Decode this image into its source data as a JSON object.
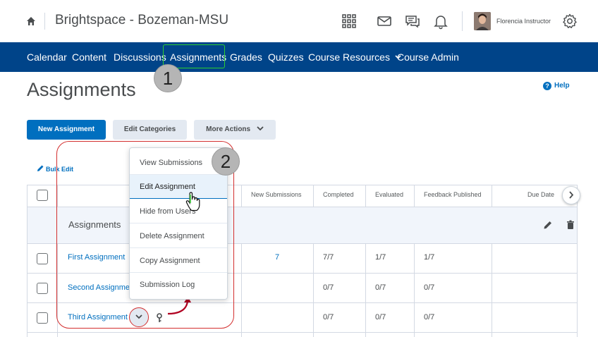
{
  "header": {
    "org_title": "Brightspace - Bozeman-MSU",
    "user_name": "Florencia Instructor",
    "icons": [
      "home-icon",
      "grid-icon",
      "mail-icon",
      "chat-icon",
      "bell-icon",
      "gear-icon"
    ]
  },
  "nav": {
    "items": [
      "Calendar",
      "Content",
      "Discussions",
      "Assignments",
      "Grades",
      "Quizzes",
      "Course Resources",
      "Course Admin"
    ],
    "active": "Assignments",
    "highlight_color": "#2fcf2f",
    "bar_color": "#004489"
  },
  "callouts": [
    "1",
    "2"
  ],
  "page": {
    "title": "Assignments",
    "help": "Help"
  },
  "actions": {
    "new_assignment": "New Assignment",
    "edit_categories": "Edit Categories",
    "more_actions": "More Actions",
    "bulk_edit": "Bulk Edit"
  },
  "table": {
    "headers": [
      "New Submissions",
      "Completed",
      "Evaluated",
      "Feedback Published",
      "Due Date"
    ],
    "group_label": "Assignments",
    "rows": [
      {
        "name": "First Assignment",
        "new_submissions": "7",
        "completed": "7/7",
        "evaluated": "1/7",
        "feedback": "1/7"
      },
      {
        "name": "Second Assignment",
        "new_submissions": "",
        "completed": "0/7",
        "evaluated": "0/7",
        "feedback": "0/7"
      },
      {
        "name": "Third Assignment",
        "new_submissions": "",
        "completed": "0/7",
        "evaluated": "0/7",
        "feedback": "0/7"
      }
    ]
  },
  "menu": {
    "items": [
      "View Submissions",
      "Edit Assignment",
      "Hide from Users",
      "Delete Assignment",
      "Copy Assignment",
      "Submission Log"
    ],
    "active": "Edit Assignment"
  },
  "colors": {
    "accent": "#006fbf",
    "annotation_red": "#d32f2f"
  }
}
